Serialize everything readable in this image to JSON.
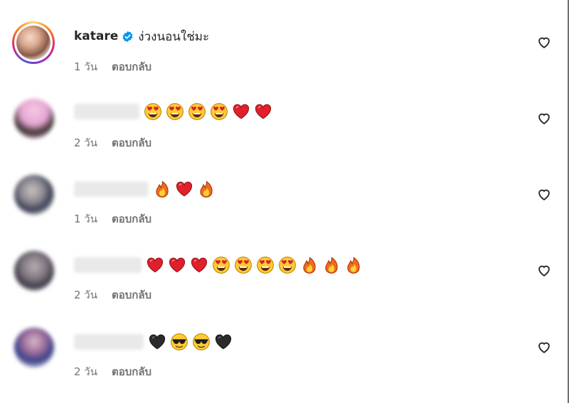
{
  "colors": {
    "text": "#262626",
    "secondary": "#737373",
    "verified": "#0095f6",
    "heart": "#e0202b"
  },
  "comments": [
    {
      "username": "katare",
      "verified": true,
      "text": "ง่วงนอนใช่มะ",
      "time": "1 วัน",
      "reply": "ตอบกลับ",
      "emojis": []
    },
    {
      "username": "",
      "verified": false,
      "text": "",
      "time": "2 วัน",
      "reply": "ตอบกลับ",
      "emojis": [
        "heart-eyes",
        "heart-eyes",
        "heart-eyes",
        "heart-eyes",
        "red-heart",
        "red-heart"
      ]
    },
    {
      "username": "",
      "verified": false,
      "text": "",
      "time": "1 วัน",
      "reply": "ตอบกลับ",
      "emojis": [
        "fire",
        "red-heart",
        "fire"
      ]
    },
    {
      "username": "",
      "verified": false,
      "text": "",
      "time": "2 วัน",
      "reply": "ตอบกลับ",
      "emojis": [
        "red-heart",
        "red-heart",
        "red-heart",
        "heart-eyes",
        "heart-eyes",
        "heart-eyes",
        "heart-eyes",
        "fire",
        "fire",
        "fire"
      ]
    },
    {
      "username": "",
      "verified": false,
      "text": "",
      "time": "2 วัน",
      "reply": "ตอบกลับ",
      "emojis": [
        "black-heart",
        "sunglasses",
        "sunglasses",
        "black-heart"
      ]
    }
  ],
  "icons": {
    "like": "heart-outline-icon",
    "verified": "verified-badge-icon"
  }
}
